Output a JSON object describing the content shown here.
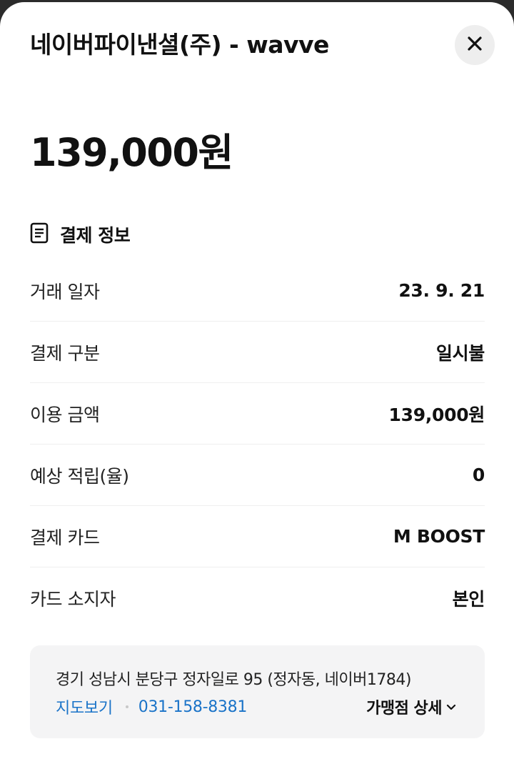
{
  "header": {
    "title": "네이버파이낸셜(주) - wavve"
  },
  "amount": "139,000원",
  "section": {
    "title": "결제 정보",
    "icon": "document-icon"
  },
  "rows": [
    {
      "label": "거래 일자",
      "value": "23. 9. 21"
    },
    {
      "label": "결제 구분",
      "value": "일시불"
    },
    {
      "label": "이용 금액",
      "value": "139,000원"
    },
    {
      "label": "예상 적립(율)",
      "value": "0"
    },
    {
      "label": "결제 카드",
      "value": "M BOOST"
    },
    {
      "label": "카드 소지자",
      "value": "본인"
    }
  ],
  "store": {
    "address": "경기 성남시 분당구 정자일로 95 (정자동, 네이버1784)",
    "map_link": "지도보기",
    "phone": "031-158-8381",
    "detail_label": "가맹점 상세"
  },
  "colors": {
    "link": "#1a73c8",
    "box_bg": "#f4f4f5",
    "close_bg": "#eeeeee"
  }
}
